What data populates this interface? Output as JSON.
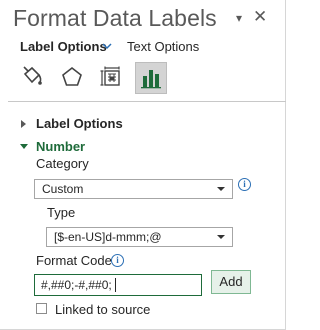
{
  "pane": {
    "title": "Format Data Labels",
    "collapse_glyph": "▾",
    "close_glyph": "✕"
  },
  "tabs": {
    "label_options": "Label Options",
    "chevron_glyph": "∨",
    "text_options": "Text Options"
  },
  "icon_tabs": [
    {
      "name": "fill-line",
      "icon": "paint-bucket-icon"
    },
    {
      "name": "effects",
      "icon": "pentagon-icon"
    },
    {
      "name": "size-properties",
      "icon": "size-properties-icon"
    },
    {
      "name": "label-options",
      "icon": "bar-chart-icon",
      "selected": true
    }
  ],
  "sections": {
    "label_options": "Label Options",
    "number": "Number"
  },
  "number": {
    "category_label": "Category",
    "category_value": "Custom",
    "type_label": "Type",
    "type_value": "[$-en-US]d-mmm;@",
    "format_code_label": "Format Code",
    "format_code_value": "#,##0;-#,##0;",
    "add_button": "Add",
    "linked_label": "Linked to source",
    "linked_checked": false,
    "info_glyph": "i"
  },
  "colors": {
    "accent_green": "#1e6b3a",
    "info_blue": "#2b6fb5",
    "title_gray": "#595959"
  }
}
